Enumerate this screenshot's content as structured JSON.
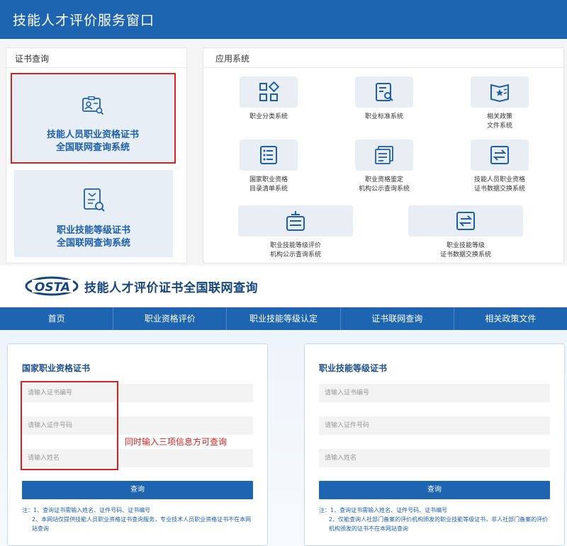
{
  "header": {
    "title": "技能人才评价服务窗口"
  },
  "cert_panel": {
    "title": "证书查询",
    "cards": [
      {
        "line1": "技能人员职业资格证书",
        "line2": "全国联网查询系统"
      },
      {
        "line1": "职业技能等级证书",
        "line2": "全国联网查询系统"
      }
    ]
  },
  "app_panel": {
    "title": "应用系统",
    "apps": [
      {
        "line1": "职业分类系统",
        "line2": "",
        "icon": "grid-icon"
      },
      {
        "line1": "职业标准系统",
        "line2": "",
        "icon": "standard-doc-icon"
      },
      {
        "line1": "相关政策",
        "line2": "文件系统",
        "icon": "policy-book-icon"
      },
      {
        "line1": "国家职业资格",
        "line2": "目录清单系统",
        "icon": "list-icon"
      },
      {
        "line1": "职业资格鉴定",
        "line2": "机构公示查询系统",
        "icon": "documents-icon"
      },
      {
        "line1": "技能人员职业资格",
        "line2": "证书数据交换系统",
        "icon": "exchange-icon"
      },
      {
        "line1": "职业技能等级评价",
        "line2": "机构公示查询系统",
        "icon": "institution-icon"
      },
      {
        "line1": "职业技能等级",
        "line2": "证书数据交换系统",
        "icon": "exchange-icon"
      }
    ]
  },
  "logo": {
    "brand": "OSTA",
    "text": "技能人才评价证书全国联网查询"
  },
  "nav": [
    "首页",
    "职业资格评价",
    "职业技能等级认定",
    "证书联网查询",
    "相关政策文件"
  ],
  "forms": [
    {
      "title": "国家职业资格证书",
      "placeholders": {
        "cert_no": "请输入证书编号",
        "id_no": "请输入证件号码",
        "name": "请输入姓名"
      },
      "button": "查询",
      "notes": [
        "注：1、查询证书需输入姓名、证件号码、证书编号",
        "2、本网站仅提供技能人员职业资格证书查询服务，专业技术人员职业资格证书不在本网",
        "站查询"
      ]
    },
    {
      "title": "职业技能等级证书",
      "placeholders": {
        "cert_no": "请输入证书编号",
        "id_no": "请输入证件号码",
        "name": "请输入姓名"
      },
      "button": "查询",
      "notes": [
        "注：1、查询证书需输入姓名、证件号码、证书编号",
        "2、仅能查询人社部门备案的评价机构颁发的职业技能等级证书，非人社部门备案的评价",
        "机构颁发的证书不在本网站查询"
      ]
    }
  ],
  "hint": "同时输入三项信息方可查询",
  "colors": {
    "primary": "#1d64b1",
    "accent_red": "#e21d1d",
    "card_bg": "#e8eef6"
  }
}
